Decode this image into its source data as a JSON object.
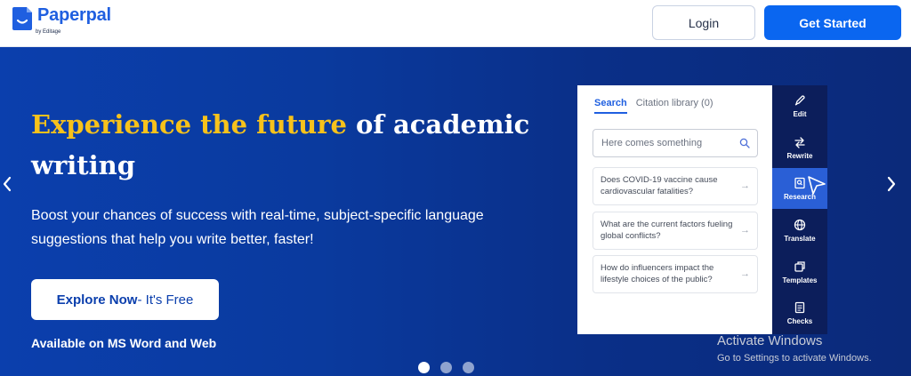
{
  "header": {
    "logo_name": "Paperpal",
    "logo_sub": "by Editage",
    "login_label": "Login",
    "start_label": "Get Started"
  },
  "hero": {
    "headline_highlight": "Experience the future",
    "headline_rest": " of academic writing",
    "subtext": "Boost your chances of success with real-time, subject-specific language suggestions that help you write better, faster!",
    "explore_label": "Explore Now",
    "explore_free": " - It's Free",
    "available": "Available on MS Word and Web",
    "slides_total": 3,
    "slide_active": 1
  },
  "panel": {
    "tabs": [
      {
        "label": "Search",
        "active": true
      },
      {
        "label": "Citation library (0)",
        "active": false
      }
    ],
    "search_placeholder": "Here comes something",
    "questions": [
      "Does COVID-19 vaccine cause cardiovascular fatalities?",
      "What are the current factors fueling global conflicts?",
      "How do influencers impact the lifestyle choices of the public?"
    ],
    "side_items": [
      {
        "label": "Edit",
        "icon": "pen-icon"
      },
      {
        "label": "Rewrite",
        "icon": "rewrite-icon"
      },
      {
        "label": "Research",
        "icon": "research-icon",
        "active": true
      },
      {
        "label": "Translate",
        "icon": "globe-icon"
      },
      {
        "label": "Templates",
        "icon": "templates-icon"
      },
      {
        "label": "Checks",
        "icon": "checks-icon"
      }
    ]
  },
  "watermark": {
    "line1": "Activate Windows",
    "line2": "Go to Settings to activate Windows."
  },
  "colors": {
    "brand_blue": "#0a66f0",
    "highlight_yellow": "#f7c21b",
    "sidebar_navy": "#0c1e5b",
    "sidebar_active": "#2a5fd6"
  }
}
